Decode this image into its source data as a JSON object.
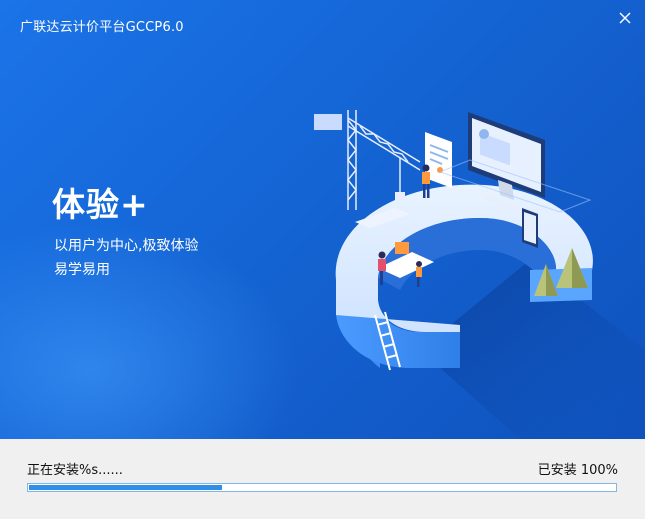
{
  "window": {
    "title": "广联达云计价平台GCCP6.0",
    "close_icon": "close-icon"
  },
  "banner": {
    "slogan_title": "体验+",
    "slogan_line1": "以用户为中心,极致体验",
    "slogan_line2": "易学易用",
    "background_color": "#1566d6",
    "illustration_icon": "isometric-office-illustration"
  },
  "footer": {
    "status_text": "正在安装%s......",
    "progress_text": "已安装 100%",
    "progress_fraction": 0.33,
    "progress_color": "#2f8fe6"
  }
}
